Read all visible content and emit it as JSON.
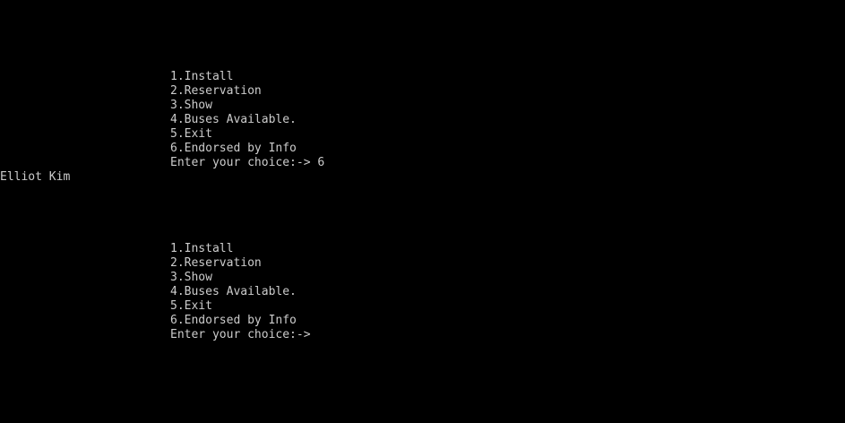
{
  "console": {
    "background": "#000000",
    "foreground": "#cccccc"
  },
  "menu_first": {
    "items": [
      "1.Install",
      "2.Reservation",
      "3.Show",
      "4.Buses Available.",
      "5.Exit",
      "6.Endorsed by Info"
    ],
    "prompt": "Enter your choice:-> 6"
  },
  "output": {
    "text": "Elliot Kim"
  },
  "menu_second": {
    "items": [
      "1.Install",
      "2.Reservation",
      "3.Show",
      "4.Buses Available.",
      "5.Exit",
      "6.Endorsed by Info"
    ],
    "prompt": "Enter your choice:->"
  }
}
